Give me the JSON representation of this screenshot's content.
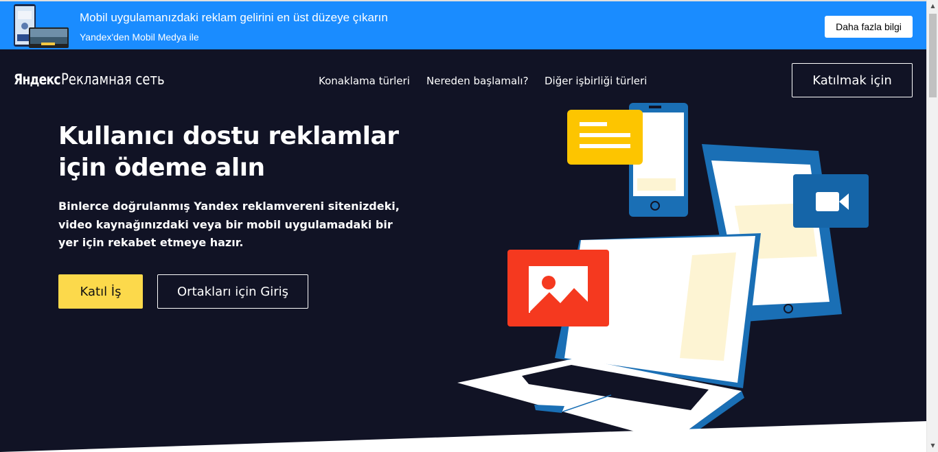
{
  "banner": {
    "title": "Mobil uygulamanızdaki reklam gelirini en üst düzeye çıkarın",
    "subtitle": "Yandex'den Mobil Medya ile",
    "button_label": "Daha fazla bilgi"
  },
  "header": {
    "logo_yandex": "Яндекс",
    "logo_product": "Рекламная сеть",
    "nav": [
      {
        "label": "Konaklama türleri"
      },
      {
        "label": "Nereden başlamalı?"
      },
      {
        "label": "Diğer işbirliği türleri"
      }
    ],
    "join_label": "Katılmak için"
  },
  "hero": {
    "title": "Kullanıcı dostu reklamlar için ödeme alın",
    "description": "Binlerce doğrulanmış Yandex reklamvereni sitenizdeki, video kaynağınızdaki veya bir mobil uygulamadaki bir yer için rekabet etmeye hazır.",
    "cta_join": "Katıl İş",
    "cta_login": "Ortakları için Giriş"
  },
  "colors": {
    "banner_bg": "#1a8cff",
    "hero_bg": "#111325",
    "accent_yellow": "#fcd94b",
    "device_blue": "#1a6fb5",
    "photo_red": "#f5391f",
    "video_blue": "#1565a8"
  },
  "icons": {
    "banner_thumbnail": "phone-ad-preview-image",
    "illustration_text": "text-lines-icon",
    "illustration_video": "video-camera-icon",
    "illustration_image": "image-icon"
  }
}
